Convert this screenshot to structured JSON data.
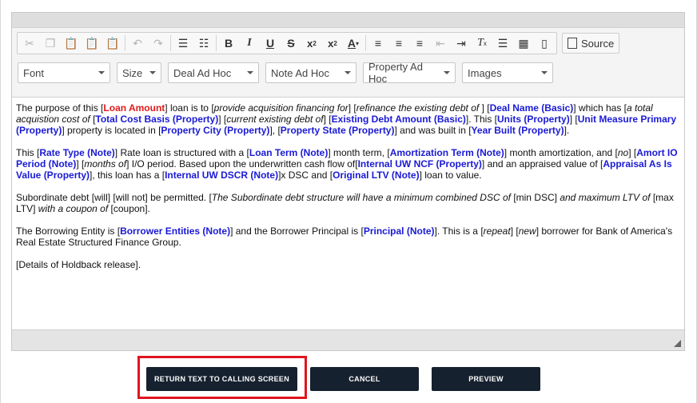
{
  "toolbar": {
    "source_label": "Source",
    "dropdowns": {
      "font": "Font",
      "size": "Size",
      "deal": "Deal Ad Hoc",
      "note": "Note Ad Hoc",
      "property": "Property Ad Hoc",
      "images": "Images"
    }
  },
  "content": {
    "p1": [
      {
        "t": "The purpose of this ["
      },
      {
        "t": "Loan Amount",
        "c": "fr"
      },
      {
        "t": "] loan is to ["
      },
      {
        "t": "provide acquisition financing for",
        "c": "em"
      },
      {
        "t": "] ["
      },
      {
        "t": "refinance the existing debt of ",
        "c": "em"
      },
      {
        "t": "] ["
      },
      {
        "t": "Deal Name (Basic)",
        "c": "fb"
      },
      {
        "t": "] which has ["
      },
      {
        "t": "a total acquistion cost of ",
        "c": "em"
      },
      {
        "t": "["
      },
      {
        "t": "Total Cost Basis (Property)",
        "c": "fb"
      },
      {
        "t": "] ["
      },
      {
        "t": "current existing debt of",
        "c": "em"
      },
      {
        "t": "] ["
      },
      {
        "t": "Existing Debt Amount (Basic)",
        "c": "fb"
      },
      {
        "t": "]. This ["
      },
      {
        "t": "Units (Property)",
        "c": "fb"
      },
      {
        "t": "] ["
      },
      {
        "t": "Unit Measure Primary (Property)",
        "c": "fb"
      },
      {
        "t": "] property is located in ["
      },
      {
        "t": "Property City (Property)",
        "c": "fb"
      },
      {
        "t": "], ["
      },
      {
        "t": "Property State (Property)",
        "c": "fb"
      },
      {
        "t": "] and was built in ["
      },
      {
        "t": "Year Built (Property)",
        "c": "fb"
      },
      {
        "t": "]."
      }
    ],
    "p2": [
      {
        "t": "This ["
      },
      {
        "t": "Rate Type (Note)",
        "c": "fb"
      },
      {
        "t": "] Rate loan is structured with a ["
      },
      {
        "t": "Loan Term (Note)",
        "c": "fb"
      },
      {
        "t": "] month term, ["
      },
      {
        "t": "Amortization Term (Note)",
        "c": "fb"
      },
      {
        "t": "] month amortization, and ["
      },
      {
        "t": "no",
        "c": "em"
      },
      {
        "t": "] ["
      },
      {
        "t": "Amort IO Period (Note)",
        "c": "fb"
      },
      {
        "t": "] ["
      },
      {
        "t": "months of",
        "c": "em"
      },
      {
        "t": "] I/O period. Based upon the underwritten cash flow of["
      },
      {
        "t": "Internal UW NCF (Property)",
        "c": "fb"
      },
      {
        "t": "] and an appraised value of ["
      },
      {
        "t": "Appraisal As Is Value (Property)",
        "c": "fb"
      },
      {
        "t": "], this loan has a ["
      },
      {
        "t": "Internal UW DSCR (Note)",
        "c": "fb"
      },
      {
        "t": "]x DSC and ["
      },
      {
        "t": "Original LTV (Note)",
        "c": "fb"
      },
      {
        "t": "] loan to value."
      }
    ],
    "p3": [
      {
        "t": "Subordinate debt [will] [will not] be permitted. ["
      },
      {
        "t": "The Subordinate debt structure will have a minimum combined DSC of ",
        "c": "em"
      },
      {
        "t": "[min DSC]"
      },
      {
        "t": " and maximum LTV of ",
        "c": "em"
      },
      {
        "t": "[max LTV]"
      },
      {
        "t": " with a coupon of ",
        "c": "em"
      },
      {
        "t": "[coupon]."
      }
    ],
    "p4": [
      {
        "t": "The Borrowing Entity is ["
      },
      {
        "t": "Borrower Entities (Note)",
        "c": "fb"
      },
      {
        "t": "] and the Borrower Principal is ["
      },
      {
        "t": "Principal (Note)",
        "c": "fb"
      },
      {
        "t": "]. This is a ["
      },
      {
        "t": "repeat",
        "c": "em"
      },
      {
        "t": "] ["
      },
      {
        "t": "new",
        "c": "em"
      },
      {
        "t": "] borrower for Bank of America's Real Estate Structured Finance Group."
      }
    ],
    "p5": [
      {
        "t": "[Details of Holdback release]."
      }
    ]
  },
  "buttons": {
    "return": "RETURN TEXT TO CALLING SCREEN",
    "cancel": "CANCEL",
    "preview": "PREVIEW"
  },
  "colors": {
    "field_blue": "#1a1ad6",
    "field_red": "#e01a1a",
    "button_bg": "#16212f",
    "highlight": "#e0141e"
  }
}
